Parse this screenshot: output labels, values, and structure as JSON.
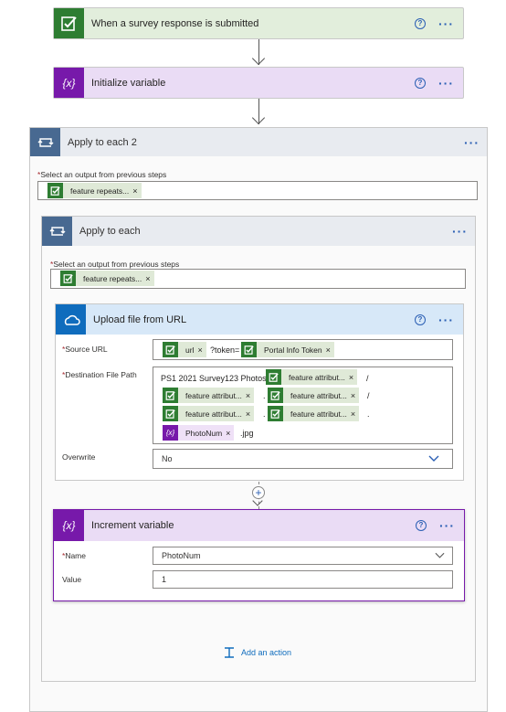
{
  "trigger": {
    "title": "When a survey response is submitted"
  },
  "init_var": {
    "title": "Initialize variable"
  },
  "apply2": {
    "title": "Apply to each 2",
    "select_label": "Select an output from previous steps",
    "token": "feature repeats..."
  },
  "apply1": {
    "title": "Apply to each",
    "select_label": "Select an output from previous steps",
    "token": "feature repeats..."
  },
  "upload": {
    "title": "Upload file from URL",
    "source_label": "Source URL",
    "source_tokens": [
      "url",
      "Portal Info Token"
    ],
    "source_text": "?token=",
    "dest_label": "Destination File Path",
    "dest_prefix": "PS1 2021 Survey123 Photos/",
    "dest_token": "feature attribut...",
    "dest_var": "PhotoNum",
    "dest_suffix": ".jpg",
    "slash": "/",
    "dot": ".",
    "overwrite_label": "Overwrite",
    "overwrite_value": "No"
  },
  "increment": {
    "title": "Increment variable",
    "name_label": "Name",
    "name_value": "PhotoNum",
    "value_label": "Value",
    "value_value": "1"
  },
  "add_action": "Add an action",
  "glyphs": {
    "help": "?",
    "dots": "···",
    "x": "×",
    "required": "*",
    "plus": "+",
    "var_icon": "{x}"
  },
  "colors": {
    "survey_green": "#2e7d32",
    "variable_purple": "#7719aa",
    "loop_blue": "#486991",
    "onedrive_blue": "#0f6cbd",
    "link_blue": "#2b5fb4"
  }
}
